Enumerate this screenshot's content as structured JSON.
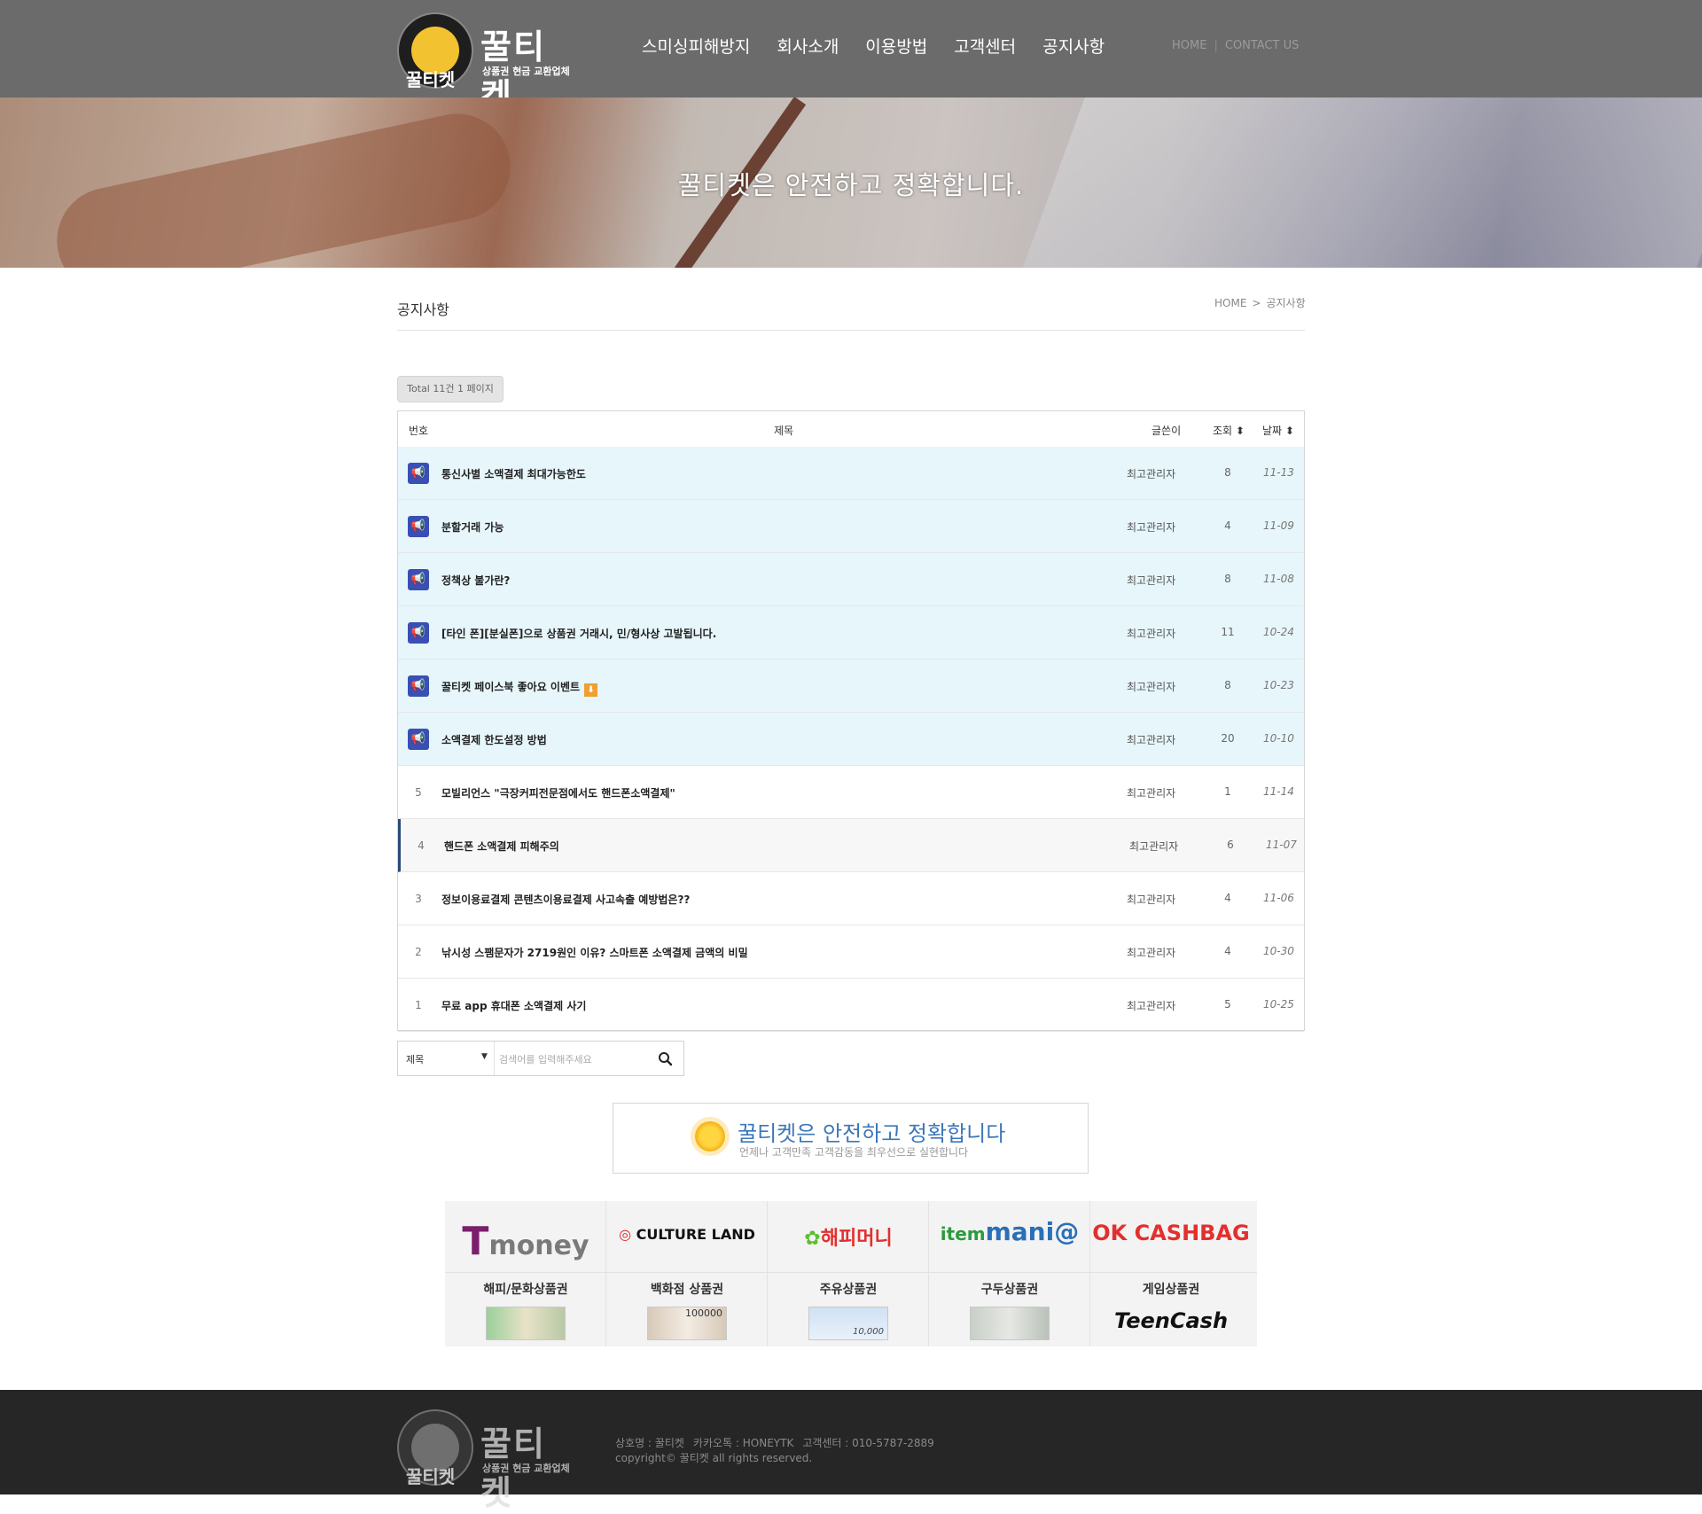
{
  "header": {
    "logo_title": "꿀티켓",
    "logo_sub": "상품권 현금 교환업체",
    "logo_ring": "꿀티켓",
    "nav": [
      "스미싱피해방지",
      "회사소개",
      "이용방법",
      "고객센터",
      "공지사항"
    ],
    "home_link": "HOME",
    "contact_link": "CONTACT US"
  },
  "banner": {
    "text": "꿀티켓은 안전하고 정확합니다."
  },
  "page": {
    "title": "공지사항",
    "breadcrumb_home": "HOME",
    "breadcrumb_sep": ">",
    "breadcrumb_current": "공지사항",
    "total": "Total 11건 1 페이지"
  },
  "board": {
    "columns": {
      "num": "번호",
      "subject": "제목",
      "writer": "글쓴이",
      "hits": "조회",
      "date": "날짜"
    },
    "rows": [
      {
        "num": "",
        "notice": true,
        "subject": "통신사별 소액결제 최대가능한도",
        "writer": "최고관리자",
        "hits": "8",
        "date": "11-13"
      },
      {
        "num": "",
        "notice": true,
        "subject": "분할거래 가능",
        "writer": "최고관리자",
        "hits": "4",
        "date": "11-09"
      },
      {
        "num": "",
        "notice": true,
        "subject": "정책상 불가란?",
        "writer": "최고관리자",
        "hits": "8",
        "date": "11-08"
      },
      {
        "num": "",
        "notice": true,
        "subject": "[타인 폰][분실폰]으로 상품권 거래시, 민/형사상 고발됩니다.",
        "writer": "최고관리자",
        "hits": "11",
        "date": "10-24"
      },
      {
        "num": "",
        "notice": true,
        "subject": "꿀티켓 페이스북 좋아요 이벤트",
        "writer": "최고관리자",
        "hits": "8",
        "date": "10-23"
      },
      {
        "num": "",
        "notice": true,
        "subject": "소액결제 한도설정 방법",
        "writer": "최고관리자",
        "hits": "20",
        "date": "10-10"
      },
      {
        "num": "5",
        "notice": false,
        "subject": "모빌리언스 \"극장커피전문점에서도 핸드폰소액결제\"",
        "writer": "최고관리자",
        "hits": "1",
        "date": "11-14"
      },
      {
        "num": "4",
        "notice": false,
        "subject": "핸드폰 소액결제 피해주의",
        "writer": "최고관리자",
        "hits": "6",
        "date": "11-07"
      },
      {
        "num": "3",
        "notice": false,
        "subject": "정보이용료결제 콘텐츠이용료결제 사고속출 예방법은??",
        "writer": "최고관리자",
        "hits": "4",
        "date": "11-06"
      },
      {
        "num": "2",
        "notice": false,
        "subject": "낚시성 스팸문자가 2719원인 이유? 스마트폰 소액결제 금액의 비밀",
        "writer": "최고관리자",
        "hits": "4",
        "date": "10-30"
      },
      {
        "num": "1",
        "notice": false,
        "subject": "무료 app 휴대폰 소액결제 사기",
        "writer": "최고관리자",
        "hits": "5",
        "date": "10-25"
      }
    ]
  },
  "search": {
    "select_value": "제목",
    "placeholder": "검색어를 입력해주세요"
  },
  "promo": {
    "title": "꿀티켓은 안전하고 정확합니다",
    "subtitle": "언제나 고객만족 고객감동을 최우선으로 실현합니다"
  },
  "partners": {
    "logos": [
      "money",
      "CULTURE LAND",
      "해피머니",
      "mani@",
      "OK CASHBAG"
    ],
    "logo_prefix": [
      "T",
      "",
      "",
      "item",
      ""
    ],
    "categories": [
      "해피/문화상품권",
      "백화점 상품권",
      "주유상품권",
      "구두상품권",
      "게임상품권"
    ],
    "teencash": "TeenCash",
    "voucher_values": [
      "100000",
      "10,000"
    ]
  },
  "footer": {
    "company": "상호명 : 꿀티켓",
    "kakao": "카카오톡 : HONEYTK",
    "center": "고객센터 : 010-5787-2889",
    "copyright": "copyright© 꿀티켓 all rights reserved."
  },
  "colors": {
    "header_bg": "#6b6b6b",
    "notice_row_bg": "#e6f6fb",
    "notice_icon": "#3a4fb3",
    "footer_bg": "#262626",
    "promo_title": "#3c77b8"
  }
}
